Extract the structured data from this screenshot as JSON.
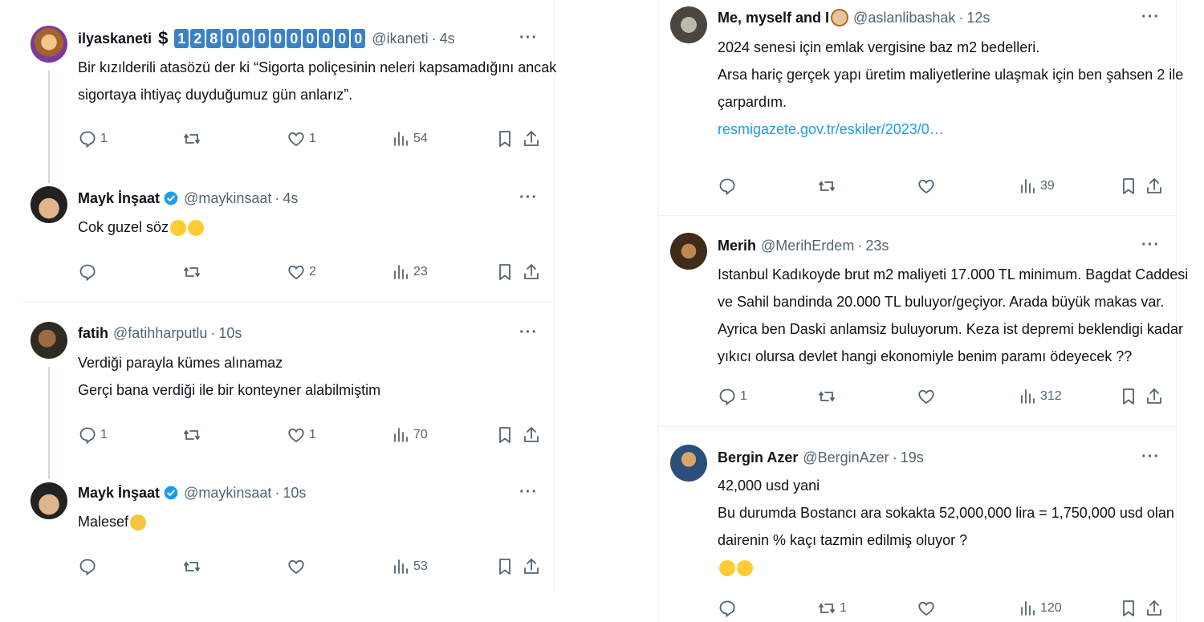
{
  "left": {
    "tweets": [
      {
        "name": "ilyaskaneti",
        "badge_digits": [
          "1",
          "2",
          "8",
          "0",
          "0",
          "0",
          "0",
          "0",
          "0",
          "0",
          "0",
          "0"
        ],
        "handle": "@ikaneti",
        "time": "4s",
        "lines": [
          "Bir kızılderili atasözü der ki “Sigorta poliçesinin neleri kapsamadığını ancak",
          "sigortaya ihtiyaç duyduğumuz gün anlarız”."
        ],
        "replies": "1",
        "retweets": "",
        "likes": "1",
        "views": "54"
      },
      {
        "name": "Mayk İnşaat",
        "handle": "@maykinsaat",
        "time": "4s",
        "lines": [
          "Cok guzel söz"
        ],
        "replies": "",
        "retweets": "",
        "likes": "2",
        "views": "23"
      },
      {
        "name": "fatih",
        "handle": "@fatihharputlu",
        "time": "10s",
        "lines": [
          "Verdiği parayla kümes alınamaz",
          "Gerçi bana verdiği ile bir konteyner alabilmiştim"
        ],
        "replies": "1",
        "retweets": "",
        "likes": "1",
        "views": "70"
      },
      {
        "name": "Mayk İnşaat",
        "handle": "@maykinsaat",
        "time": "10s",
        "lines": [
          "Malesef"
        ],
        "replies": "",
        "retweets": "",
        "likes": "",
        "views": "53"
      }
    ]
  },
  "right": {
    "tweets": [
      {
        "name": "Me, myself and I",
        "handle": "@aslanlibashak",
        "time": "12s",
        "lines": [
          "2024 senesi için emlak vergisine baz m2 bedelleri.",
          "Arsa hariç gerçek yapı üretim maliyetlerine ulaşmak için ben şahsen 2 ile",
          "çarpardım."
        ],
        "link": "resmigazete.gov.tr/eskiler/2023/0…",
        "replies": "",
        "retweets": "",
        "likes": "",
        "views": "39"
      },
      {
        "name": "Merih",
        "handle": "@MerihErdem",
        "time": "23s",
        "lines": [
          "Istanbul Kadıkoyde  brut m2 maliyeti 17.000 TL minimum. Bagdat Caddesi",
          "ve Sahil bandinda 20.000 TL buluyor/geçiyor. Arada büyük makas var.",
          "Ayrica ben Daski anlamsiz buluyorum. Keza ist depremi beklendigi kadar",
          "yıkıcı olursa devlet hangi ekonomiyle benim paramı ödeyecek ??"
        ],
        "replies": "1",
        "retweets": "",
        "likes": "",
        "views": "312"
      },
      {
        "name": "Bergin Azer",
        "handle": "@BerginAzer",
        "time": "19s",
        "lines": [
          "42,000 usd yani",
          "Bu durumda Bostancı ara sokakta 52,000,000 lira = 1,750,000 usd olan",
          "dairenin % kaçı tazmin edilmiş oluyor ?"
        ],
        "replies": "",
        "retweets": "1",
        "likes": "",
        "views": "120"
      }
    ]
  },
  "colors": {
    "accent": "#1d9bf0",
    "muted": "#536471",
    "badge": "#3b82c4"
  },
  "icons": [
    "reply-icon",
    "retweet-icon",
    "like-icon",
    "views-icon",
    "bookmark-icon",
    "share-icon",
    "more-icon",
    "verified-icon"
  ]
}
